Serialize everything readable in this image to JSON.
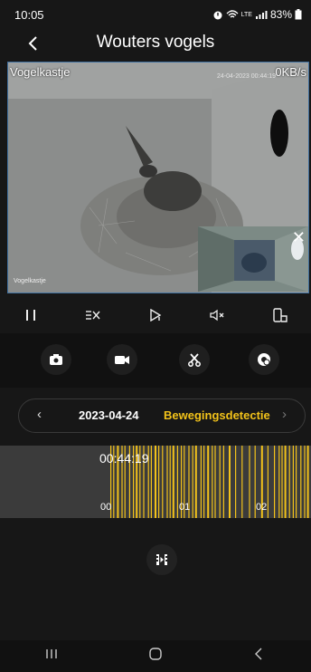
{
  "status": {
    "time": "10:05",
    "battery": "83%"
  },
  "header": {
    "title": "Wouters vogels"
  },
  "video": {
    "camera_name": "Vogelkastje",
    "bitrate": "0KB/s",
    "timestamp": "24-04-2023 00:44:19",
    "bottom_label": "Vogelkastje"
  },
  "pip": {
    "close": "✕"
  },
  "controls": {
    "pause": "| |",
    "quality": "≡X",
    "next": "▷",
    "mute": "◁×",
    "orientation": "▯"
  },
  "datebar": {
    "prev": "‹",
    "date": "2023-04-24",
    "filter": "Bewegingsdetectie",
    "next": "›"
  },
  "timeline": {
    "current_time": "00:44:19",
    "ticks": [
      "00",
      "01",
      "02"
    ]
  },
  "colors": {
    "accent": "#f2c21a",
    "background": "#171717"
  }
}
